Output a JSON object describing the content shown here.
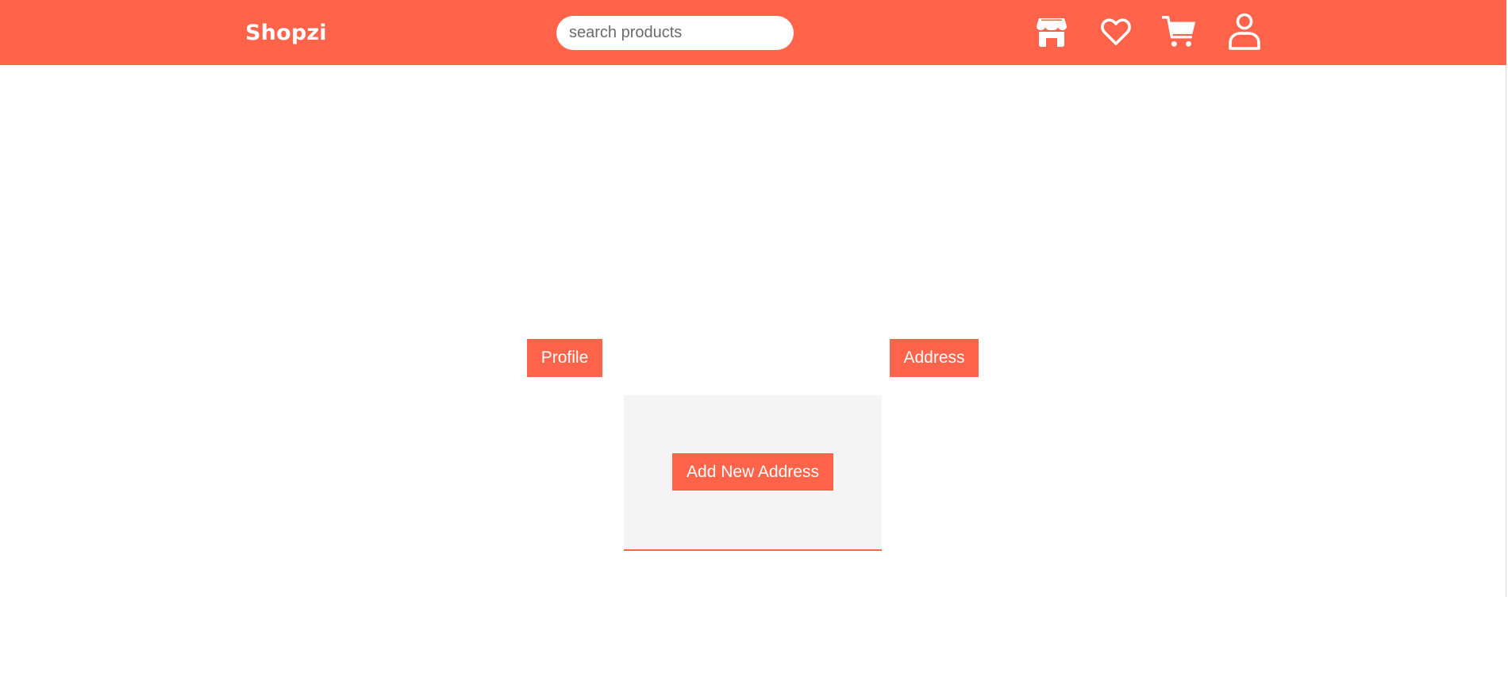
{
  "header": {
    "brand": "Shopzi",
    "search_placeholder": "search products",
    "icons": [
      "store-icon",
      "heart-icon",
      "cart-icon",
      "user-icon"
    ]
  },
  "account": {
    "profile_label": "Profile",
    "address_label": "Address"
  },
  "address_card": {
    "add_label": "Add New Address"
  },
  "colors": {
    "accent": "#ff634a",
    "card_bg": "#f4f4f4"
  }
}
